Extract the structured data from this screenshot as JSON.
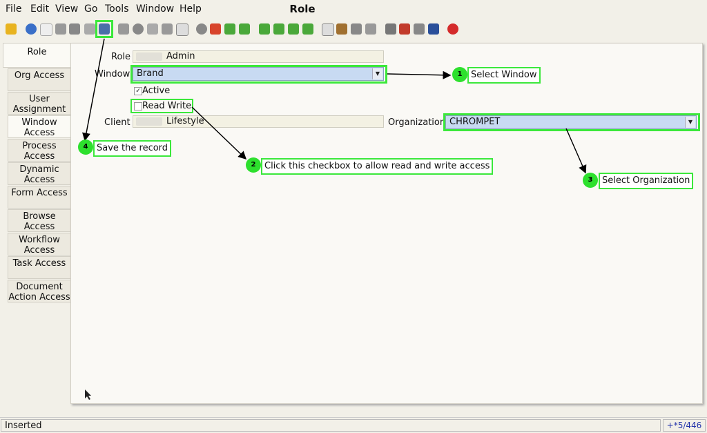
{
  "menu": {
    "file": "File",
    "edit": "Edit",
    "view": "View",
    "go": "Go",
    "tools": "Tools",
    "window": "Window",
    "help": "Help"
  },
  "window_title": "Role",
  "tabs": [
    {
      "label": "Role"
    },
    {
      "label": "Org Access"
    },
    {
      "label": "User Assignment"
    },
    {
      "label": "Window Access"
    },
    {
      "label": "Process Access"
    },
    {
      "label": "Dynamic Access"
    },
    {
      "label": "Form Access"
    },
    {
      "label": "Browse Access"
    },
    {
      "label": "Workflow Access"
    },
    {
      "label": "Task Access"
    },
    {
      "label": "Document Action Access"
    }
  ],
  "form": {
    "role_label": "Role",
    "role_value": "Admin",
    "window_label": "Window",
    "window_value": "Brand",
    "active_label": "Active",
    "readwrite_label": "Read Write",
    "client_label": "Client",
    "client_value": "Lifestyle",
    "org_label": "Organization",
    "org_value": "CHROMPET"
  },
  "callouts": [
    {
      "num": "1",
      "text": "Select Window"
    },
    {
      "num": "2",
      "text": "Click this checkbox to allow read and write access"
    },
    {
      "num": "3",
      "text": "Select Organization"
    },
    {
      "num": "4",
      "text": "Save the record"
    }
  ],
  "status": {
    "left": "Inserted",
    "right": "+*5/446"
  },
  "colors": {
    "highlight": "#3be83b",
    "badge": "#2de02d",
    "combo": "#c8daf2"
  }
}
